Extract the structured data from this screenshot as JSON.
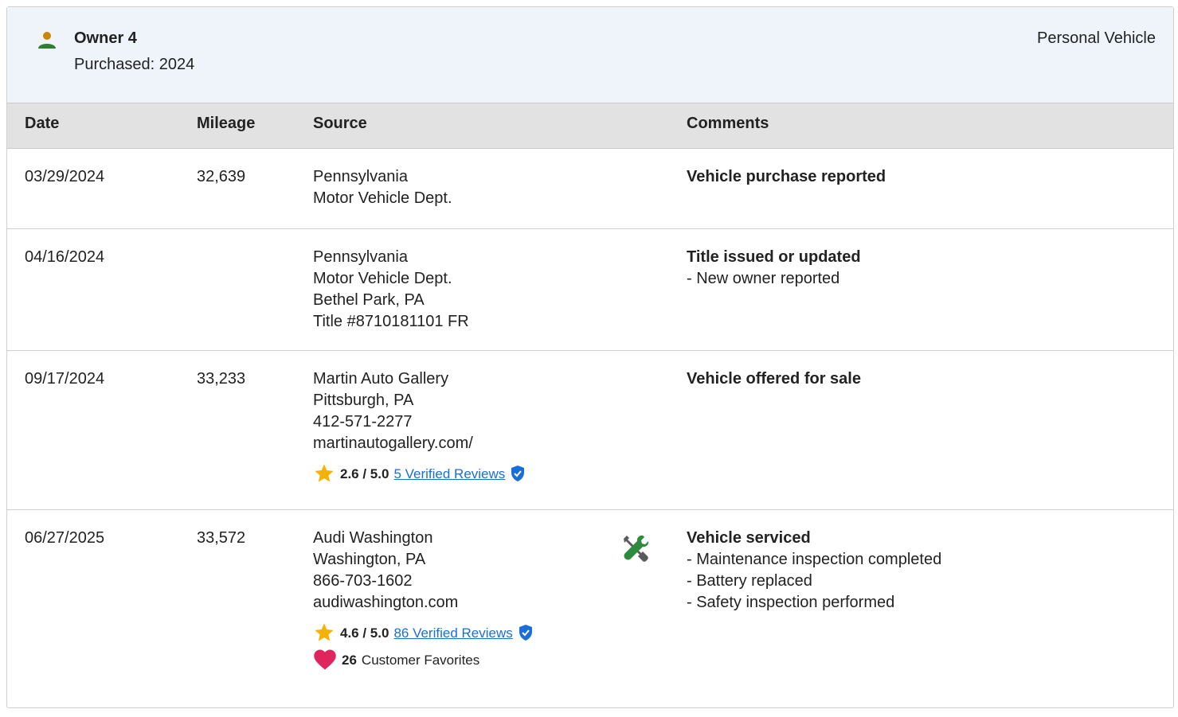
{
  "owner": {
    "title": "Owner 4",
    "purchased": "Purchased: 2024",
    "use_type": "Personal Vehicle"
  },
  "table": {
    "headers": {
      "date": "Date",
      "mileage": "Mileage",
      "source": "Source",
      "comments": "Comments"
    },
    "rows": [
      {
        "date": "03/29/2024",
        "mileage": "32,639",
        "source": [
          "Pennsylvania",
          "Motor Vehicle Dept."
        ],
        "comment_title": "Vehicle purchase reported",
        "comment_items": []
      },
      {
        "date": "04/16/2024",
        "mileage": "",
        "source": [
          "Pennsylvania",
          "Motor Vehicle Dept.",
          "Bethel Park, PA",
          "Title #8710181101 FR"
        ],
        "comment_title": "Title issued or updated",
        "comment_items": [
          "- New owner reported"
        ]
      },
      {
        "date": "09/17/2024",
        "mileage": "33,233",
        "source": [
          "Martin Auto Gallery",
          "Pittsburgh, PA",
          "412-571-2277",
          "martinautogallery.com/"
        ],
        "rating": {
          "score": "2.6 / 5.0",
          "reviews_link": "5 Verified Reviews"
        },
        "comment_title": "Vehicle offered for sale",
        "comment_items": []
      },
      {
        "date": "06/27/2025",
        "mileage": "33,572",
        "source": [
          "Audi Washington",
          "Washington, PA",
          "866-703-1602",
          "audiwashington.com"
        ],
        "rating": {
          "score": "4.6 / 5.0",
          "reviews_link": "86 Verified Reviews"
        },
        "favorites": {
          "count": "26",
          "label": "Customer Favorites"
        },
        "service_icon": "wrench-screwdriver-icon",
        "comment_title": "Vehicle serviced",
        "comment_items": [
          "- Maintenance inspection completed",
          "- Battery replaced",
          "- Safety inspection performed"
        ]
      }
    ]
  },
  "colors": {
    "header_bg": "#eef4fa",
    "table_header_bg": "#e2e2e2",
    "link": "#1a6ed8",
    "star": "#f5b301",
    "heart": "#e0245e",
    "owner_icon_head": "#c8860b",
    "owner_icon_body": "#2e7d32",
    "service_icon_green": "#2e8b3e"
  }
}
